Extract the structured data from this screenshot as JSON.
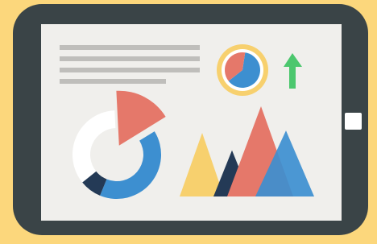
{
  "colors": {
    "background": "#FCD77C",
    "tablet_frame": "#3A4447",
    "screen": "#F0EFEC",
    "home_button": "#FFFFFF",
    "text_lines": "#BFBEBB",
    "blue": "#3D8FD0",
    "coral": "#E5786A",
    "navy": "#243A56",
    "white_segment": "#FFFFFF",
    "yellow": "#F7D06E",
    "green_arrow": "#4CC76E"
  },
  "icons": {
    "trend": "arrow-up-icon"
  },
  "donut_chart": {
    "segments": [
      {
        "color": "blue",
        "share": 0.4
      },
      {
        "color": "navy",
        "share": 0.08
      },
      {
        "color": "white_segment",
        "share": 0.35
      },
      {
        "color": "coral",
        "share": 0.17,
        "exploded": true
      }
    ]
  },
  "mini_pie": {
    "segments": [
      {
        "color": "blue",
        "share": 0.62
      },
      {
        "color": "coral",
        "share": 0.38
      }
    ]
  },
  "peaks": [
    {
      "color": "yellow",
      "relative_height": 0.55
    },
    {
      "color": "navy",
      "relative_height": 0.4
    },
    {
      "color": "coral",
      "relative_height": 0.78
    },
    {
      "color": "blue",
      "relative_height": 0.57
    }
  ]
}
